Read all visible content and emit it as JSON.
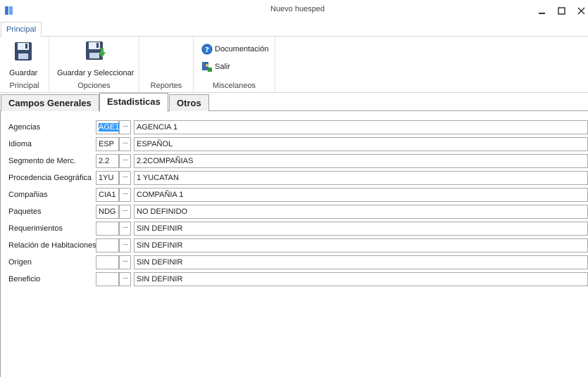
{
  "window": {
    "title": "Nuevo huesped"
  },
  "ribbon": {
    "tab": "Principal",
    "groups": [
      {
        "label": "Principal",
        "buttons": [
          "Guardar"
        ]
      },
      {
        "label": "Opciones",
        "buttons": [
          "Guardar y Seleccionar"
        ]
      },
      {
        "label": "Reportes",
        "buttons": []
      },
      {
        "label": "Miscelaneos",
        "buttons": [
          "Documentación",
          "Salir"
        ]
      }
    ]
  },
  "tabs": [
    "Campos Generales",
    "Estadisticas",
    "Otros"
  ],
  "active_tab": "Estadisticas",
  "fields": [
    {
      "label": "Agencias",
      "code": "AGE1",
      "description": "AGENCIA 1"
    },
    {
      "label": "Idioma",
      "code": "ESP",
      "description": "ESPAÑOL"
    },
    {
      "label": "Segmento de Merc.",
      "code": "2.2",
      "description": "2.2COMPAÑIAS"
    },
    {
      "label": "Procedencia Geográfica",
      "code": "1YU",
      "description": "1 YUCATAN"
    },
    {
      "label": "Compañias",
      "code": "CIA1",
      "description": "COMPAÑIA 1"
    },
    {
      "label": "Paquetes",
      "code": "NDG",
      "description": "NO DEFINIDO"
    },
    {
      "label": "Requerimientos",
      "code": "",
      "description": "SIN DEFINIR"
    },
    {
      "label": "Relación de Habitaciones",
      "code": "",
      "description": "SIN DEFINIR"
    },
    {
      "label": "Origen",
      "code": "",
      "description": "SIN DEFINIR"
    },
    {
      "label": "Beneficio",
      "code": "",
      "description": "SIN DEFINIR"
    }
  ],
  "ellipsis": "···",
  "colors": {
    "accent": "#2a5a9a",
    "selection": "#3399ff"
  },
  "icons": [
    "app-icon",
    "minimize-icon",
    "maximize-icon",
    "close-icon",
    "save-icon",
    "save-select-icon",
    "help-icon",
    "exit-icon"
  ]
}
